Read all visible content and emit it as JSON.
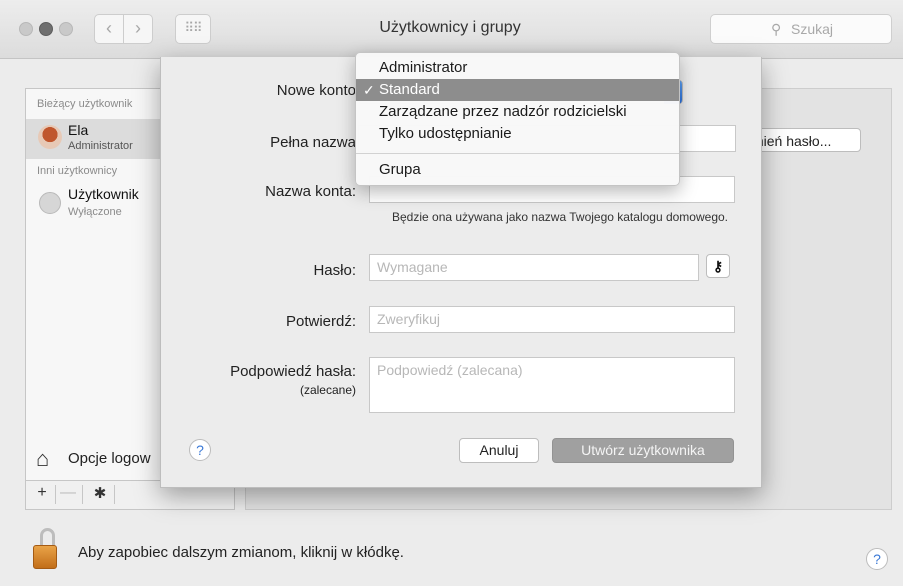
{
  "window": {
    "title": "Użytkownicy i grupy",
    "search_placeholder": "Szukaj",
    "nav_back": "‹",
    "nav_forward": "›",
    "grid_glyph": "⠿⠿"
  },
  "sidebar": {
    "current_users_label": "Bieżący użytkownik",
    "current_user": {
      "name": "Ela",
      "role": "Administrator"
    },
    "other_users_label": "Inni użytkownicy",
    "other_user": {
      "name": "Użytkownik",
      "status": "Wyłączone"
    },
    "login_options_label": "Opcje logow",
    "tools": {
      "add": "+",
      "remove": "—",
      "gear": "✱"
    }
  },
  "background": {
    "reset_password_label": "mień hasło..."
  },
  "sheet": {
    "new_account_label": "Nowe konto",
    "full_name_label": "Pełna nazwa",
    "account_name_label": "Nazwa konta:",
    "account_name_hint": "Będzie ona używana jako nazwa Twojego katalogu domowego.",
    "password_label": "Hasło:",
    "password_placeholder": "Wymagane",
    "verify_label": "Potwierdź:",
    "verify_placeholder": "Zweryfikuj",
    "hint_label": "Podpowiedź hasła:",
    "hint_sublabel": "(zalecane)",
    "hint_placeholder": "Podpowiedź (zalecana)",
    "help": "?",
    "cancel_button": "Anuluj",
    "create_button": "Utwórz użytkownika"
  },
  "account_type_menu": {
    "selected": "Standard",
    "items": [
      {
        "label": "Administrator"
      },
      {
        "label": "Standard",
        "checked": true
      },
      {
        "label": "Zarządzane przez nadzór rodzicielski"
      },
      {
        "label": "Tylko udostępnianie"
      },
      {
        "label": "Grupa"
      }
    ],
    "check_glyph": "✓"
  },
  "footer": {
    "lock_text": "Aby zapobiec dalszym zmianom, kliknij w kłódkę.",
    "help": "?"
  },
  "colors": {
    "menu_highlight": "#8d8d8d",
    "lock": "#d88a2c",
    "help_blue": "#3b79d6"
  }
}
